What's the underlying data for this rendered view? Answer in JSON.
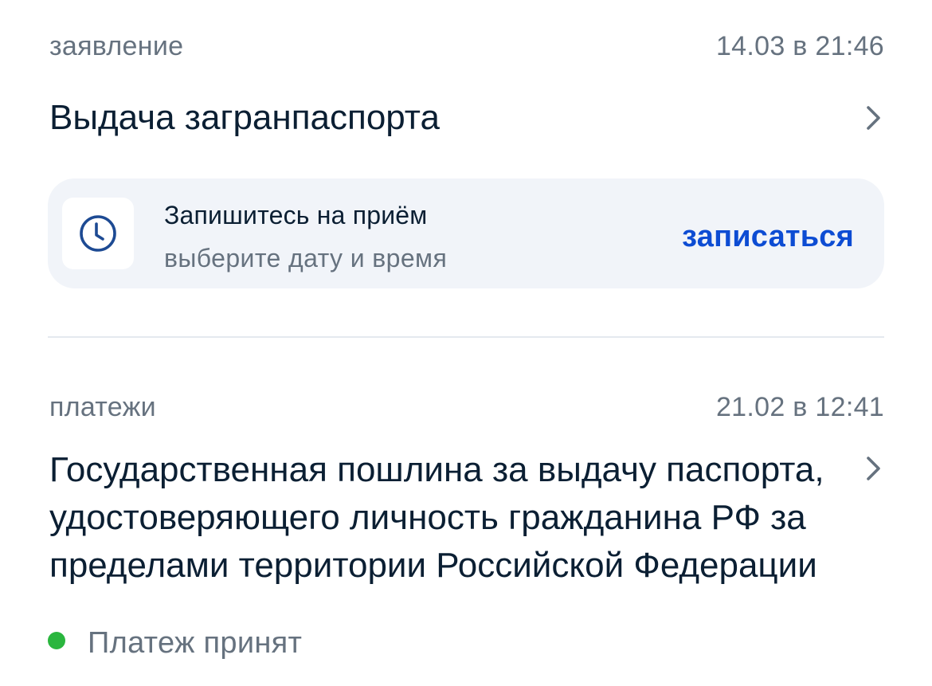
{
  "feed": {
    "items": [
      {
        "type_label": "заявление",
        "date": "14.03 в 21:46",
        "title": "Выдача загранпаспорта",
        "appointment": {
          "title": "Запишитесь на приём",
          "subtitle": "выберите дату и время",
          "action_label": "записаться",
          "icon": "clock-icon"
        }
      },
      {
        "type_label": "платежи",
        "date": "21.02 в 12:41",
        "title": "Государственная пошлина за выдачу паспорта, удостоверяющего личность гражданина РФ за пределами территории Российской Федерации",
        "status": {
          "text": "Платеж принят",
          "color": "#2ab63e"
        }
      }
    ]
  },
  "colors": {
    "primary_text": "#0b1f33",
    "secondary_text": "#66727f",
    "accent": "#0d4cd3",
    "card_background": "#f1f4f9",
    "divider": "#e4e9ef"
  }
}
